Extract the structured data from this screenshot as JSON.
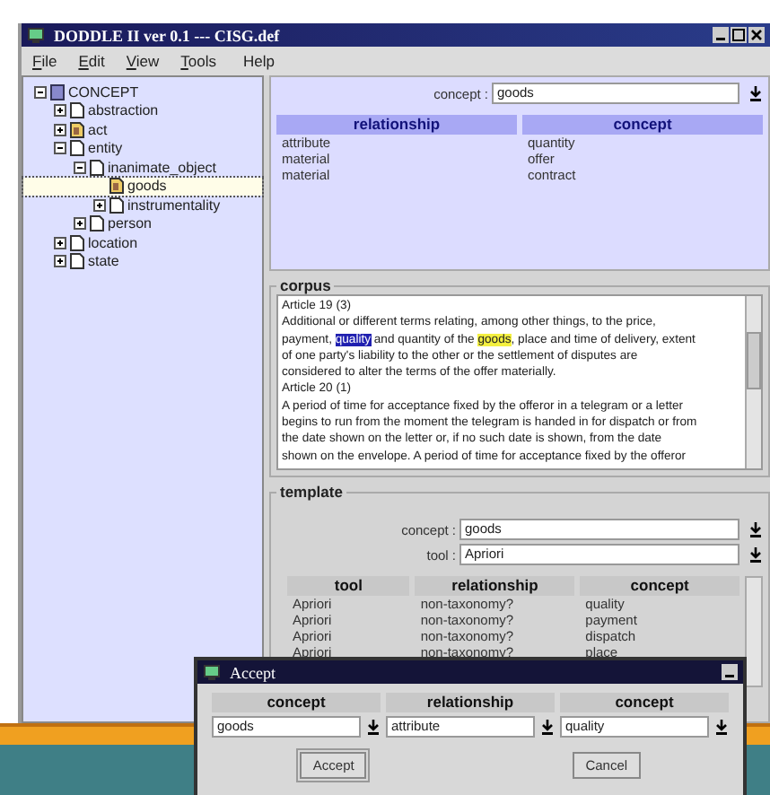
{
  "window": {
    "title": "DODDLE II ver 0.1 --- CISG.def"
  },
  "menu": {
    "left": [
      "File",
      "Edit",
      "View",
      "Tools"
    ],
    "right": [
      "Help"
    ]
  },
  "tree": [
    {
      "label": "CONCEPT",
      "kind": "root",
      "expanded": true,
      "selected": false,
      "children": [
        {
          "label": "abstraction",
          "kind": "doc",
          "expanded": false,
          "selected": false
        },
        {
          "label": "act",
          "kind": "marked",
          "expanded": false,
          "selected": false
        },
        {
          "label": "entity",
          "kind": "doc",
          "expanded": true,
          "selected": false,
          "children": [
            {
              "label": "inanimate_object",
              "kind": "doc",
              "expanded": true,
              "selected": false,
              "children": [
                {
                  "label": "goods",
                  "kind": "marked",
                  "selected": true
                },
                {
                  "label": "instrumentality",
                  "kind": "doc",
                  "expanded": false,
                  "selected": false
                }
              ]
            },
            {
              "label": "person",
              "kind": "doc",
              "expanded": false,
              "selected": false
            }
          ]
        },
        {
          "label": "location",
          "kind": "doc",
          "expanded": false,
          "selected": false
        },
        {
          "label": "state",
          "kind": "doc",
          "expanded": false,
          "selected": false
        }
      ]
    }
  ],
  "concept_panel": {
    "label": "concept :",
    "value": "goods",
    "columns": [
      "relationship",
      "concept"
    ],
    "rows": [
      [
        "attribute",
        "quantity"
      ],
      [
        "material",
        "offer"
      ],
      [
        "material",
        "contract"
      ]
    ]
  },
  "corpus": {
    "title": "corpus",
    "lines": [
      [
        {
          "text": "Article 19 (3)",
          "kind": "plain"
        }
      ],
      [
        {
          "text": "Additional or different terms relating, among other things, to the price,",
          "kind": "plain"
        }
      ],
      [
        {
          "text": "payment, ",
          "kind": "plain"
        },
        {
          "text": "quality",
          "kind": "selection"
        },
        {
          "text": " and quantity of the ",
          "kind": "plain"
        },
        {
          "text": "goods",
          "kind": "match"
        },
        {
          "text": ", place and time of delivery, extent",
          "kind": "plain"
        }
      ],
      [
        {
          "text": "of one party's liability to the other or the settlement of disputes are",
          "kind": "plain"
        }
      ],
      [
        {
          "text": "considered to alter the terms of the offer materially.",
          "kind": "plain"
        }
      ],
      [
        {
          "text": "Article 20 (1)",
          "kind": "plain"
        }
      ],
      [
        {
          "text": "A period of time for acceptance fixed by the offeror in a telegram or a letter",
          "kind": "plain"
        }
      ],
      [
        {
          "text": "begins to run from the moment the telegram is handed in for dispatch or from",
          "kind": "plain"
        }
      ],
      [
        {
          "text": "the date shown on the letter or, if no such date is shown, from the date",
          "kind": "plain"
        }
      ],
      [
        {
          "text": "shown on the envelope.  A period of time for acceptance fixed by the offeror",
          "kind": "plain"
        }
      ]
    ]
  },
  "template": {
    "title": "template",
    "fields": [
      {
        "label": "concept :",
        "value": "goods"
      },
      {
        "label": "tool :",
        "value": "Apriori"
      }
    ],
    "columns": [
      "tool",
      "relationship",
      "concept"
    ],
    "rows": [
      [
        "Apriori",
        "non-taxonomy?",
        "quality"
      ],
      [
        "Apriori",
        "non-taxonomy?",
        "payment"
      ],
      [
        "Apriori",
        "non-taxonomy?",
        "dispatch"
      ],
      [
        "Apriori",
        "non-taxonomy?",
        "place"
      ]
    ]
  },
  "dialog": {
    "title": "Accept",
    "columns": [
      "concept",
      "relationship",
      "concept"
    ],
    "values": [
      "goods",
      "attribute",
      "quality"
    ],
    "buttons": [
      "Accept",
      "Cancel"
    ]
  }
}
